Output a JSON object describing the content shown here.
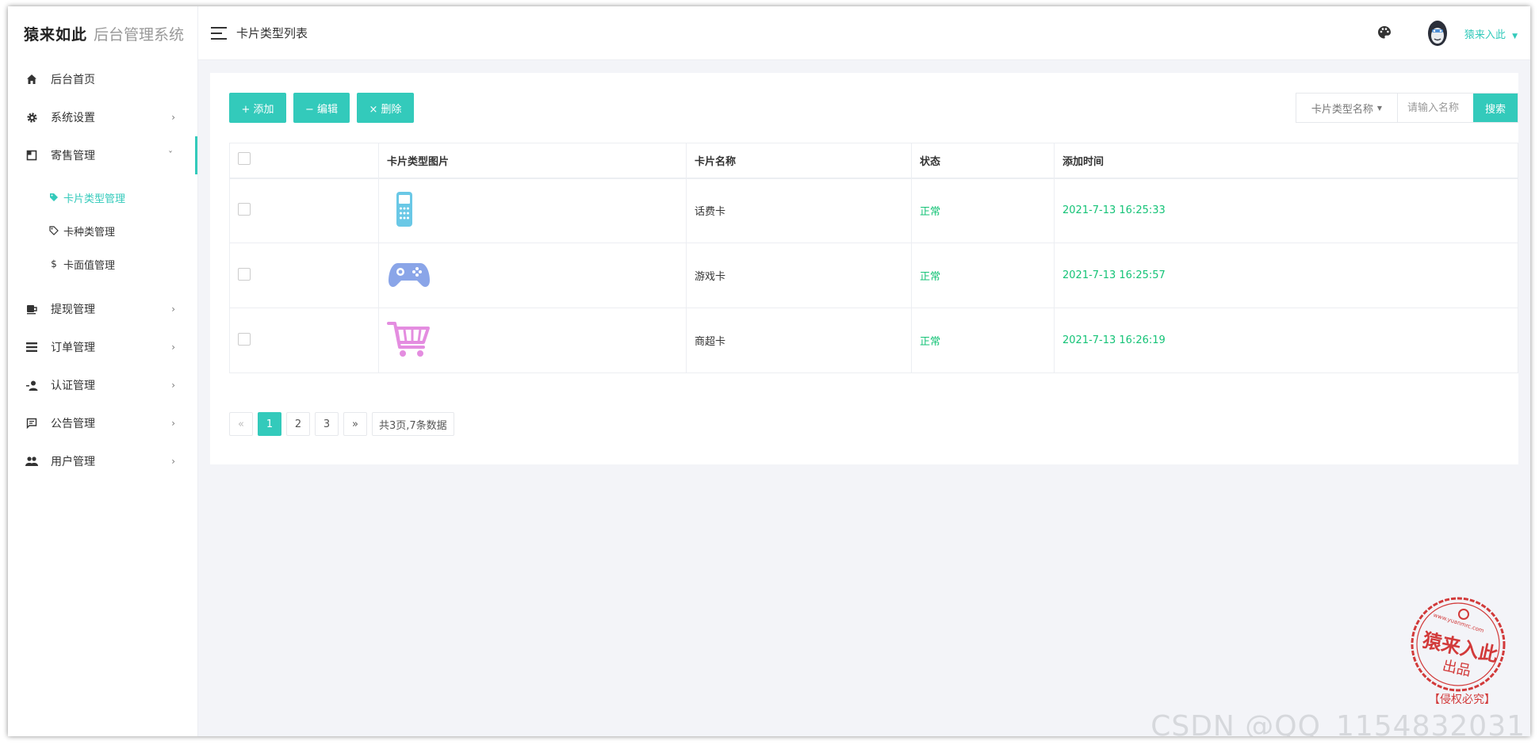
{
  "brand": {
    "logo": "猿来如此",
    "system": "后台管理系统"
  },
  "sidebar": {
    "items": [
      {
        "label": "后台首页",
        "icon": "home-icon"
      },
      {
        "label": "系统设置",
        "icon": "gear-icon"
      },
      {
        "label": "寄售管理",
        "icon": "consign-icon"
      },
      {
        "label": "提现管理",
        "icon": "withdraw-icon"
      },
      {
        "label": "订单管理",
        "icon": "list-icon"
      },
      {
        "label": "认证管理",
        "icon": "user-check-icon"
      },
      {
        "label": "公告管理",
        "icon": "message-icon"
      },
      {
        "label": "用户管理",
        "icon": "users-icon"
      }
    ],
    "sub_items": [
      {
        "label": "卡片类型管理",
        "icon": "tag-icon"
      },
      {
        "label": "卡种类管理",
        "icon": "tag-outline-icon"
      },
      {
        "label": "卡面值管理",
        "icon": "dollar-icon"
      }
    ]
  },
  "header": {
    "title": "卡片类型列表",
    "user": "猿来入此"
  },
  "toolbar": {
    "add": "+ 添加",
    "edit": "− 编辑",
    "delete": "× 删除"
  },
  "search": {
    "field": "卡片类型名称",
    "placeholder": "请输入名称",
    "button": "搜索"
  },
  "table": {
    "headers": [
      "卡片类型图片",
      "卡片名称",
      "状态",
      "添加时间"
    ],
    "rows": [
      {
        "name": "话费卡",
        "status": "正常",
        "time": "2021-7-13 16:25:33",
        "icon": "phone-icon"
      },
      {
        "name": "游戏卡",
        "status": "正常",
        "time": "2021-7-13 16:25:57",
        "icon": "gamepad-icon"
      },
      {
        "name": "商超卡",
        "status": "正常",
        "time": "2021-7-13 16:26:19",
        "icon": "cart-icon"
      }
    ]
  },
  "pagination": {
    "prev": "«",
    "pages": [
      "1",
      "2",
      "3"
    ],
    "next": "»",
    "summary": "共3页,7条数据"
  },
  "watermark": {
    "seal_text": "猿来入此",
    "seal_sub": "出品",
    "seal_url": "www.yuanmrc.com",
    "seal_bottom": "【侵权必究】",
    "csdn": "CSDN @QQ_1154832031"
  },
  "colors": {
    "accent": "#33cabb",
    "status_green": "#15c377"
  }
}
